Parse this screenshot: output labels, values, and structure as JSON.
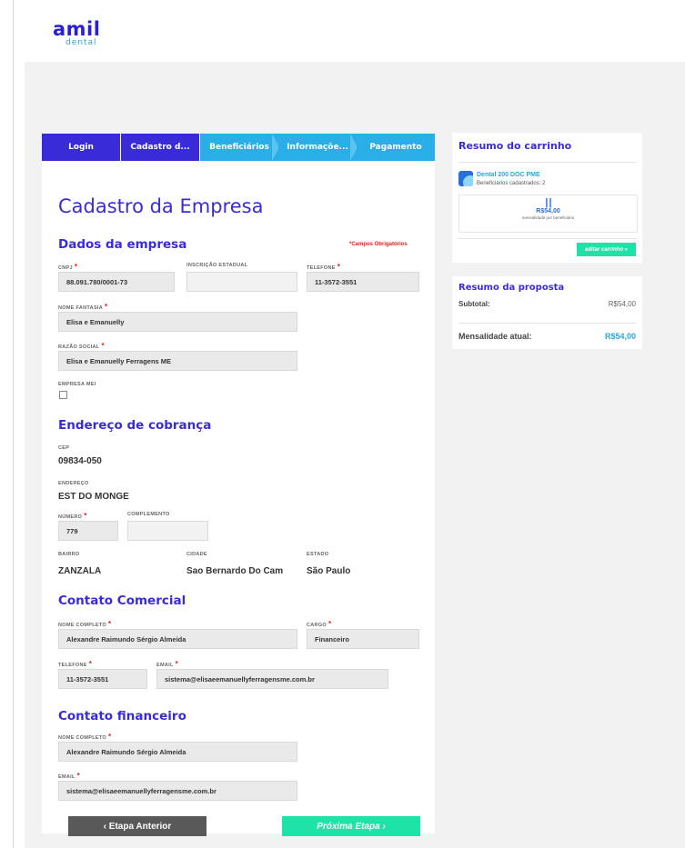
{
  "header": {
    "logo_main": "amil",
    "logo_sub": "dental"
  },
  "steps": [
    "Login",
    "Cadastro d...",
    "Beneficiários",
    "Informaçõe...",
    "Pagamento"
  ],
  "form": {
    "title": "Cadastro da Empresa",
    "required_note": "*Campos Obrigatórios",
    "dados": {
      "section": "Dados da empresa",
      "cnpj_label": "CNPJ",
      "cnpj": "88.091.780/0001-73",
      "ie_label": "INSCRIÇÃO ESTADUAL",
      "ie": "",
      "tel_label": "TELEFONE",
      "tel": "11-3572-3551",
      "fantasia_label": "NOME FANTASIA",
      "fantasia": "Elisa e Emanuelly",
      "razao_label": "RAZÃO SOCIAL",
      "razao": "Elisa e Emanuelly Ferragens ME",
      "mei_label": "EMPRESA MEI"
    },
    "endereco": {
      "section": "Endereço de cobrança",
      "cep_label": "CEP",
      "cep": "09834-050",
      "end_label": "ENDEREÇO",
      "end": "EST DO MONGE",
      "num_label": "NÚMERO",
      "num": "779",
      "comp_label": "COMPLEMENTO",
      "comp": "",
      "bairro_label": "BAIRRO",
      "bairro": "ZANZALA",
      "cidade_label": "CIDADE",
      "cidade": "Sao Bernardo Do Cam",
      "estado_label": "ESTADO",
      "estado": "São Paulo"
    },
    "comercial": {
      "section": "Contato Comercial",
      "nome_label": "NOME COMPLETO",
      "nome": "Alexandre Raimundo Sérgio Almeida",
      "cargo_label": "CARGO",
      "cargo": "Financeiro",
      "tel_label": "TELEFONE",
      "tel": "11-3572-3551",
      "email_label": "EMAIL",
      "email": "sistema@elisaeemanuellyferragensme.com.br"
    },
    "financeiro": {
      "section": "Contato financeiro",
      "nome_label": "NOME COMPLETO",
      "nome": "Alexandre Raimundo Sérgio Almeida",
      "email_label": "EMAIL",
      "email": "sistema@elisaeemanuellyferragensme.com.br"
    },
    "prev_button": "‹  Etapa Anterior",
    "next_button": "Próxima Etapa  ›"
  },
  "cart": {
    "title": "Resumo do carrinho",
    "product": "Dental 200 DOC PME",
    "beneficiaries": "Beneficiários cadastrados: 2",
    "price_bars": "| |",
    "price": "R$54,00",
    "price_sub": "mensalidade por beneficiário",
    "edit_button": "editar carrinho »"
  },
  "proposal": {
    "title": "Resumo da proposta",
    "subtotal_label": "Subtotal:",
    "subtotal": "R$54,00",
    "mensal_label": "Mensalidade atual:",
    "mensal": "R$54,00"
  },
  "colors": {
    "primary": "#3a2bd8",
    "step_active": "#3a2bd8",
    "step_inactive": "#29aee8",
    "accent_green": "#1ee3a6",
    "required": "#e02020"
  }
}
